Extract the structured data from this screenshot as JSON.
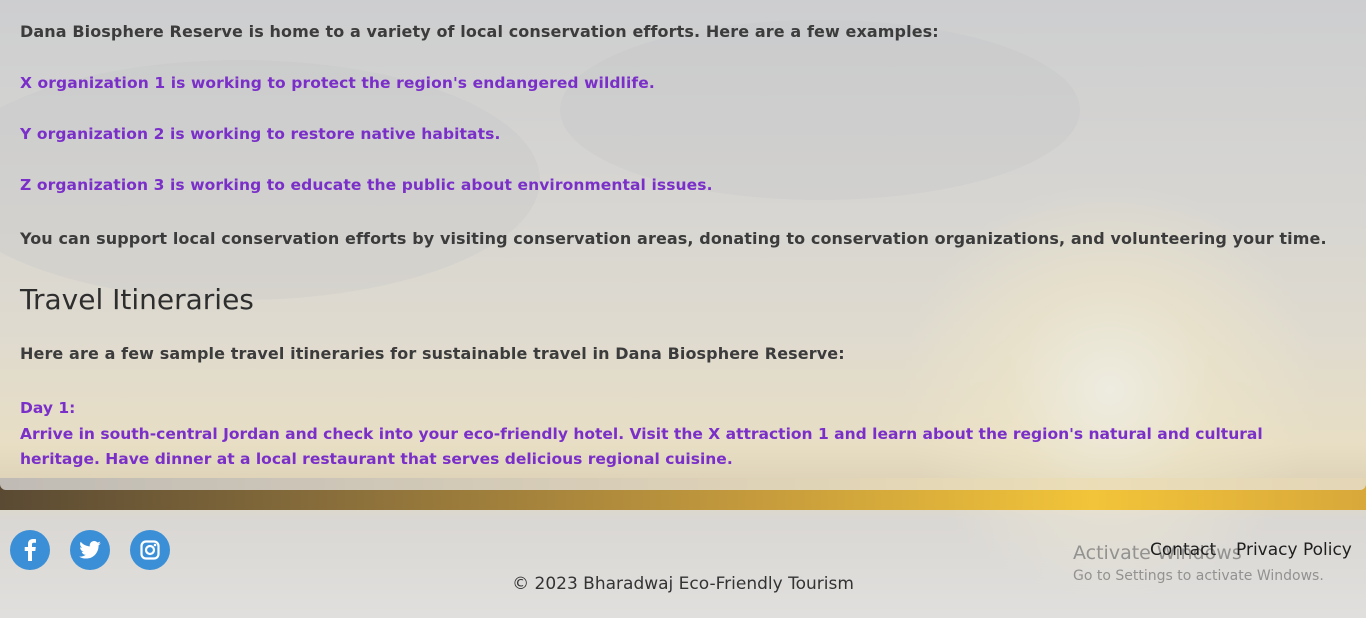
{
  "conservation": {
    "intro": "Dana Biosphere Reserve is home to a variety of local conservation efforts. Here are a few examples:",
    "examples": [
      "X organization 1 is working to protect the region's endangered wildlife.",
      "Y organization 2 is working to restore native habitats.",
      "Z organization 3 is working to educate the public about environmental issues."
    ],
    "support": "You can support local conservation efforts by visiting conservation areas, donating to conservation organizations, and volunteering your time."
  },
  "itineraries": {
    "heading": "Travel Itineraries",
    "intro": "Here are a few sample travel itineraries for sustainable travel in Dana Biosphere Reserve:",
    "day_label": "Day 1:",
    "day_text": "Arrive in south-central Jordan and check into your eco-friendly hotel. Visit the X attraction 1 and learn about the region's natural and cultural heritage. Have dinner at a local restaurant that serves delicious regional cuisine."
  },
  "footer": {
    "social": [
      {
        "icon": "facebook-icon"
      },
      {
        "icon": "twitter-icon"
      },
      {
        "icon": "instagram-icon"
      }
    ],
    "copyright": "© 2023 Bharadwaj Eco-Friendly Tourism",
    "links": [
      "Contact",
      "Privacy Policy"
    ]
  },
  "windows_watermark": {
    "title": "Activate Windows",
    "subtitle": "Go to Settings to activate Windows."
  },
  "colors": {
    "accent_purple": "#7b2fc9",
    "social_blue": "#3a8fd6"
  }
}
